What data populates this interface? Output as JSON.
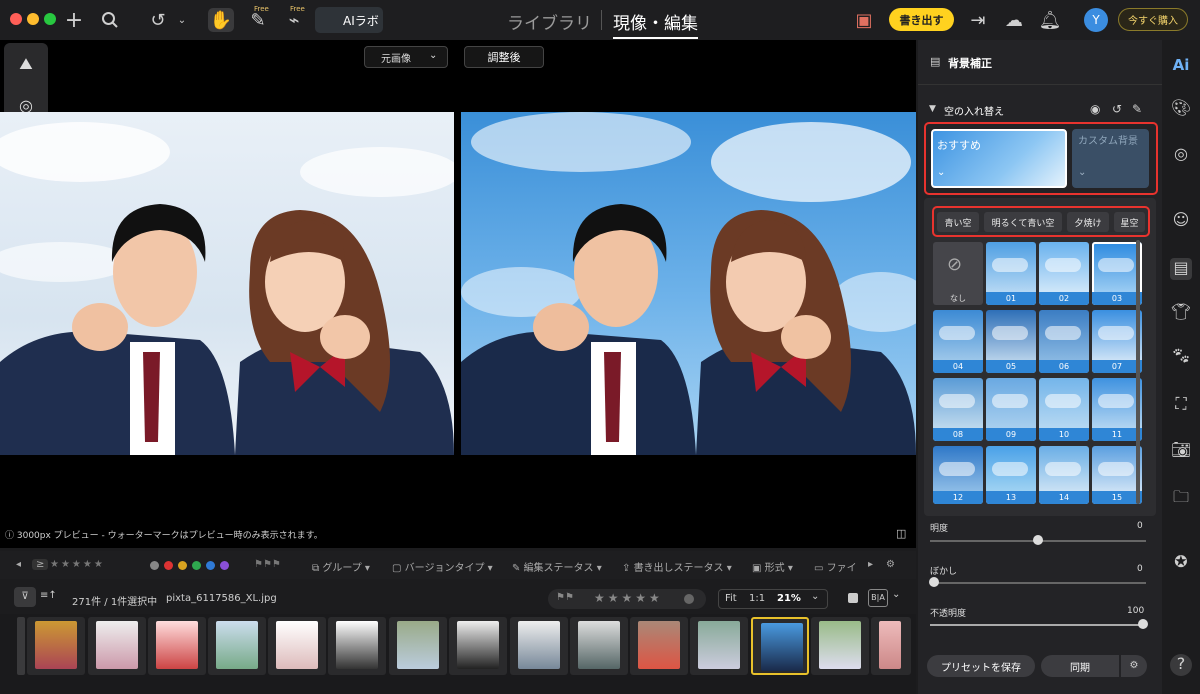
{
  "topbar": {
    "ailab_label": "AIラボ",
    "free1": "Free",
    "free2": "Free",
    "tab_library": "ライブラリ",
    "tab_develop": "現像・編集",
    "export_label": "書き出す",
    "avatar_initial": "Y",
    "buy_label": "今すぐ購入"
  },
  "viewer": {
    "original_select": "元画像",
    "after_label": "調整後",
    "notice": "3000px プレビュー - ウォーターマークはプレビュー時のみ表示されます。"
  },
  "filterbar": {
    "gte": "≥",
    "group": "グループ",
    "version": "バージョンタイプ",
    "edit_status": "編集ステータス",
    "export_status": "書き出しステータス",
    "format": "形式",
    "file": "ファイ"
  },
  "infobar": {
    "count": "271件 / 1件選択中",
    "filename": "pixta_6117586_XL.jpg",
    "fit": "Fit",
    "one_to_one": "1:1",
    "zoom": "21%"
  },
  "panel": {
    "title": "背景補正",
    "section": "空の入れ替え",
    "recommended": "おすすめ",
    "custom": "カスタム背景",
    "chips": [
      "青い空",
      "明るくて青い空",
      "夕焼け",
      "星空"
    ],
    "none_label": "なし",
    "skies": [
      "01",
      "02",
      "03",
      "04",
      "05",
      "06",
      "07",
      "08",
      "09",
      "10",
      "11",
      "12",
      "13",
      "14",
      "15"
    ],
    "brightness_label": "明度",
    "brightness_value": "0",
    "blur_label": "ぼかし",
    "blur_value": "0",
    "opacity_label": "不透明度",
    "opacity_value": "100",
    "save_preset": "プリセットを保存",
    "sync": "同期"
  },
  "colors": {
    "accent_yellow": "#ffd21f",
    "selection_blue": "#2f86d6",
    "highlight_red": "#e8332e"
  }
}
